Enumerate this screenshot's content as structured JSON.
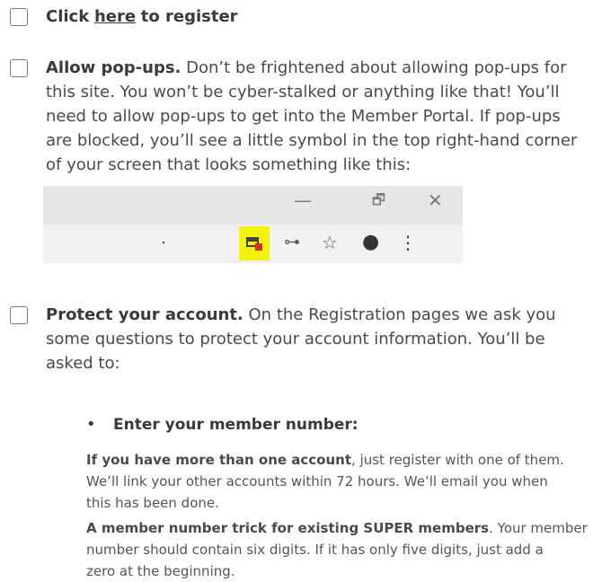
{
  "item1": {
    "click": "Click",
    "here": "here",
    "rest": "to register"
  },
  "item2": {
    "heading": "Allow pop-ups.",
    "line1": "Don’t be frightened about allowing pop-ups for",
    "line2": "this site. You won’t be cyber-stalked or anything like that! You’ll",
    "line3": "need to allow pop-ups to get into the Member Portal. If pop-ups",
    "line4": "are blocked, you’ll see a little symbol in the top right-hand corner",
    "line5": "of your screen that looks something like this:"
  },
  "browser": {
    "minimize": "—",
    "restore": "🗗",
    "close": "✕",
    "key": "⊶",
    "star": "☆",
    "account": "●",
    "menu": "⋮",
    "highlight_color": "#f2f20f",
    "popup_badge_color": "#d9302a"
  },
  "item3": {
    "heading": "Protect your account.",
    "line1": "On the Registration pages we ask you",
    "line2": "some questions to protect your account information. You’ll be",
    "line3": "asked to:"
  },
  "bullet": {
    "marker": "•",
    "heading": "Enter your member number:",
    "p1_bold": "If you have more than one account",
    "p1_rest": ", just register with one of them.",
    "p1_line2": "We’ll link your other accounts within 72 hours. We’ll email you when",
    "p1_line3": "this has been done.",
    "p2_bold": "A member number trick for existing SUPER members",
    "p2_rest": ". Your member",
    "p2_line2": "number should contain six digits. If it has only five digits, just add a",
    "p2_line3": "zero at the beginning."
  }
}
